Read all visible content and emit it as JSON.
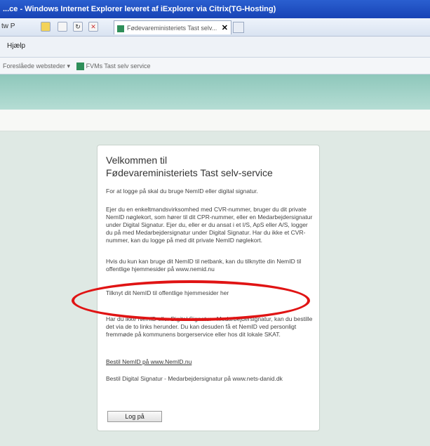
{
  "window": {
    "title": "...ce - Windows Internet Explorer leveret af iExplorer via Citrix(TG-Hosting)"
  },
  "toolbar": {
    "address_fragment": "tw P",
    "tab_label": "Fødevareministeriets Tast selv...",
    "tab_close": "✕"
  },
  "menubar": {
    "help_label": "Hjælp"
  },
  "favorites": {
    "suggested_label": "Foreslåede websteder ▾",
    "link_label": "FVMs Tast selv service"
  },
  "panel": {
    "title_line1": "Velkommen til",
    "title_line2": "Fødevareministeriets Tast selv-service",
    "p1": "For at logge på skal du bruge NemID eller digital signatur.",
    "p2": "Ejer du en enkeltmandsvirksomhed med CVR-nummer, bruger du dit private NemID nøglekort, som hører til dit CPR-nummer, eller en Medarbejdersignatur under Digital Signatur. Ejer du, eller er du ansat i et I/S, ApS eller A/S, logger du på med Medarbejdersignatur under Digital Signatur. Har du ikke et CVR-nummer, kan du logge på med dit private NemID nøglekort.",
    "p3": "Hvis du kun kan bruge dit NemID til netbank, kan du tilknytte din NemID til offentlige hjemmesider på www.nemid.nu",
    "p4": "Tilknyt dit NemID til offentlige hjemmesider her",
    "p5": "Har du ikke NemID eller Digital Signatur - Medarbejdersignatur, kan du bestille det via de to links herunder. Du kan desuden få et NemID ved personligt fremmøde på kommunens borgerservice eller hos dit lokale SKAT.",
    "link1": "Bestil NemID på www.NemID.nu",
    "p6": "Bestil Digital Signatur - Medarbejdersignatur på www.nets-danid.dk",
    "login_button": "Log på"
  },
  "colors": {
    "highlight_ring": "#e01414",
    "header_band": "#8ec7bb"
  }
}
